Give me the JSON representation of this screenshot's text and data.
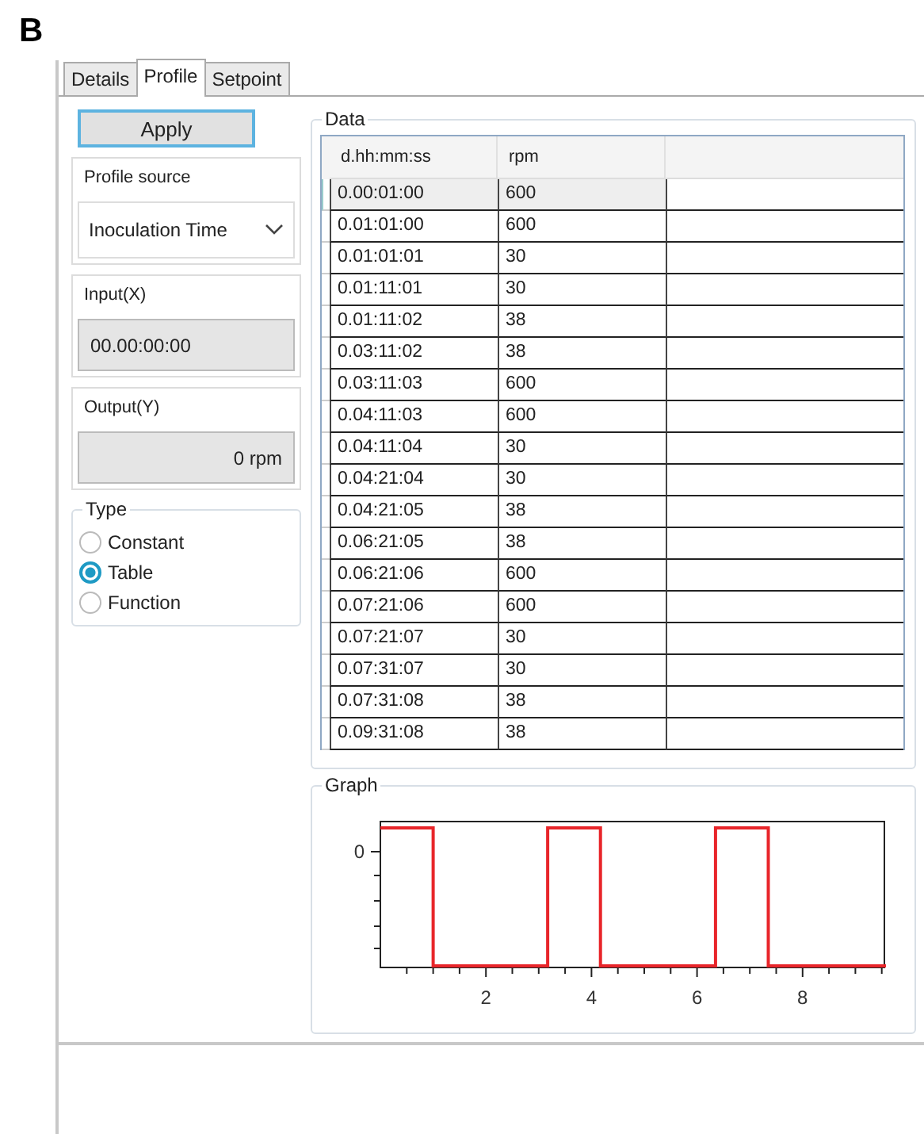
{
  "figure_label": "B",
  "tabs": [
    {
      "label": "Details",
      "selected": false
    },
    {
      "label": "Profile",
      "selected": true
    },
    {
      "label": "Setpoint",
      "selected": false
    }
  ],
  "apply_button": "Apply",
  "profile_source": {
    "label": "Profile source",
    "value": "Inoculation Time"
  },
  "input": {
    "label": "Input(X)",
    "value": "00.00:00:00"
  },
  "output": {
    "label": "Output(Y)",
    "value": "0 rpm"
  },
  "type": {
    "label": "Type",
    "options": [
      {
        "label": "Constant",
        "selected": false
      },
      {
        "label": "Table",
        "selected": true
      },
      {
        "label": "Function",
        "selected": false
      }
    ]
  },
  "data": {
    "title": "Data",
    "columns": [
      "d.hh:mm:ss",
      "rpm"
    ],
    "rows": [
      {
        "cells": [
          "0.00:01:00",
          "600"
        ],
        "selected": true
      },
      {
        "cells": [
          "0.01:01:00",
          "600"
        ],
        "selected": false
      },
      {
        "cells": [
          "0.01:01:01",
          "30"
        ],
        "selected": false
      },
      {
        "cells": [
          "0.01:11:01",
          "30"
        ],
        "selected": false
      },
      {
        "cells": [
          "0.01:11:02",
          "38"
        ],
        "selected": false
      },
      {
        "cells": [
          "0.03:11:02",
          "38"
        ],
        "selected": false
      },
      {
        "cells": [
          "0.03:11:03",
          "600"
        ],
        "selected": false
      },
      {
        "cells": [
          "0.04:11:03",
          "600"
        ],
        "selected": false
      },
      {
        "cells": [
          "0.04:11:04",
          "30"
        ],
        "selected": false
      },
      {
        "cells": [
          "0.04:21:04",
          "30"
        ],
        "selected": false
      },
      {
        "cells": [
          "0.04:21:05",
          "38"
        ],
        "selected": false
      },
      {
        "cells": [
          "0.06:21:05",
          "38"
        ],
        "selected": false
      },
      {
        "cells": [
          "0.06:21:06",
          "600"
        ],
        "selected": false
      },
      {
        "cells": [
          "0.07:21:06",
          "600"
        ],
        "selected": false
      },
      {
        "cells": [
          "0.07:21:07",
          "30"
        ],
        "selected": false
      },
      {
        "cells": [
          "0.07:31:07",
          "30"
        ],
        "selected": false
      },
      {
        "cells": [
          "0.07:31:08",
          "38"
        ],
        "selected": false
      },
      {
        "cells": [
          "0.09:31:08",
          "38"
        ],
        "selected": false
      }
    ]
  },
  "graph": {
    "title": "Graph",
    "y_tick_labels": [
      "0"
    ],
    "x_tick_labels": [
      "2",
      "4",
      "6",
      "8"
    ]
  }
}
